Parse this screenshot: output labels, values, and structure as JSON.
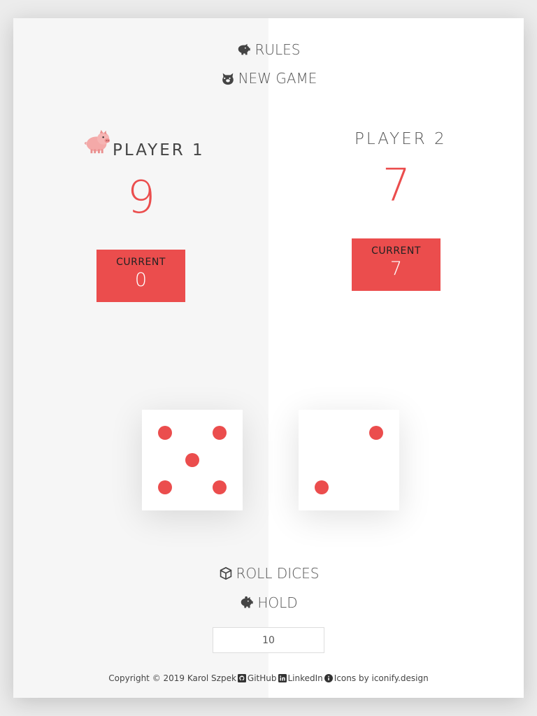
{
  "menu": {
    "rules_label": "RULES",
    "new_game_label": "NEW GAME",
    "roll_label": "ROLL DICES",
    "hold_label": "HOLD"
  },
  "players": [
    {
      "name": "PLAYER 1",
      "score": "9",
      "current_label": "CURRENT",
      "current": "0",
      "active": true
    },
    {
      "name": "PLAYER 2",
      "score": "7",
      "current_label": "CURRENT",
      "current": "7",
      "active": false
    }
  ],
  "dice": [
    5,
    2
  ],
  "goal": {
    "value": "10"
  },
  "footer": {
    "copyright": "Copyright © 2019 Karol Szpek",
    "github": "GitHub",
    "linkedin": "LinkedIn",
    "icons_credit": "Icons by iconify.design"
  },
  "colors": {
    "accent": "#eb4d4d",
    "panel_active": "#f6f6f6",
    "panel_inactive": "#ffffff"
  },
  "icons": {
    "rules": "piggy-bank-icon",
    "new_game": "pig-face-icon",
    "roll": "cube-icon",
    "hold": "piggy-bank-icon",
    "active_player": "pig-icon"
  }
}
